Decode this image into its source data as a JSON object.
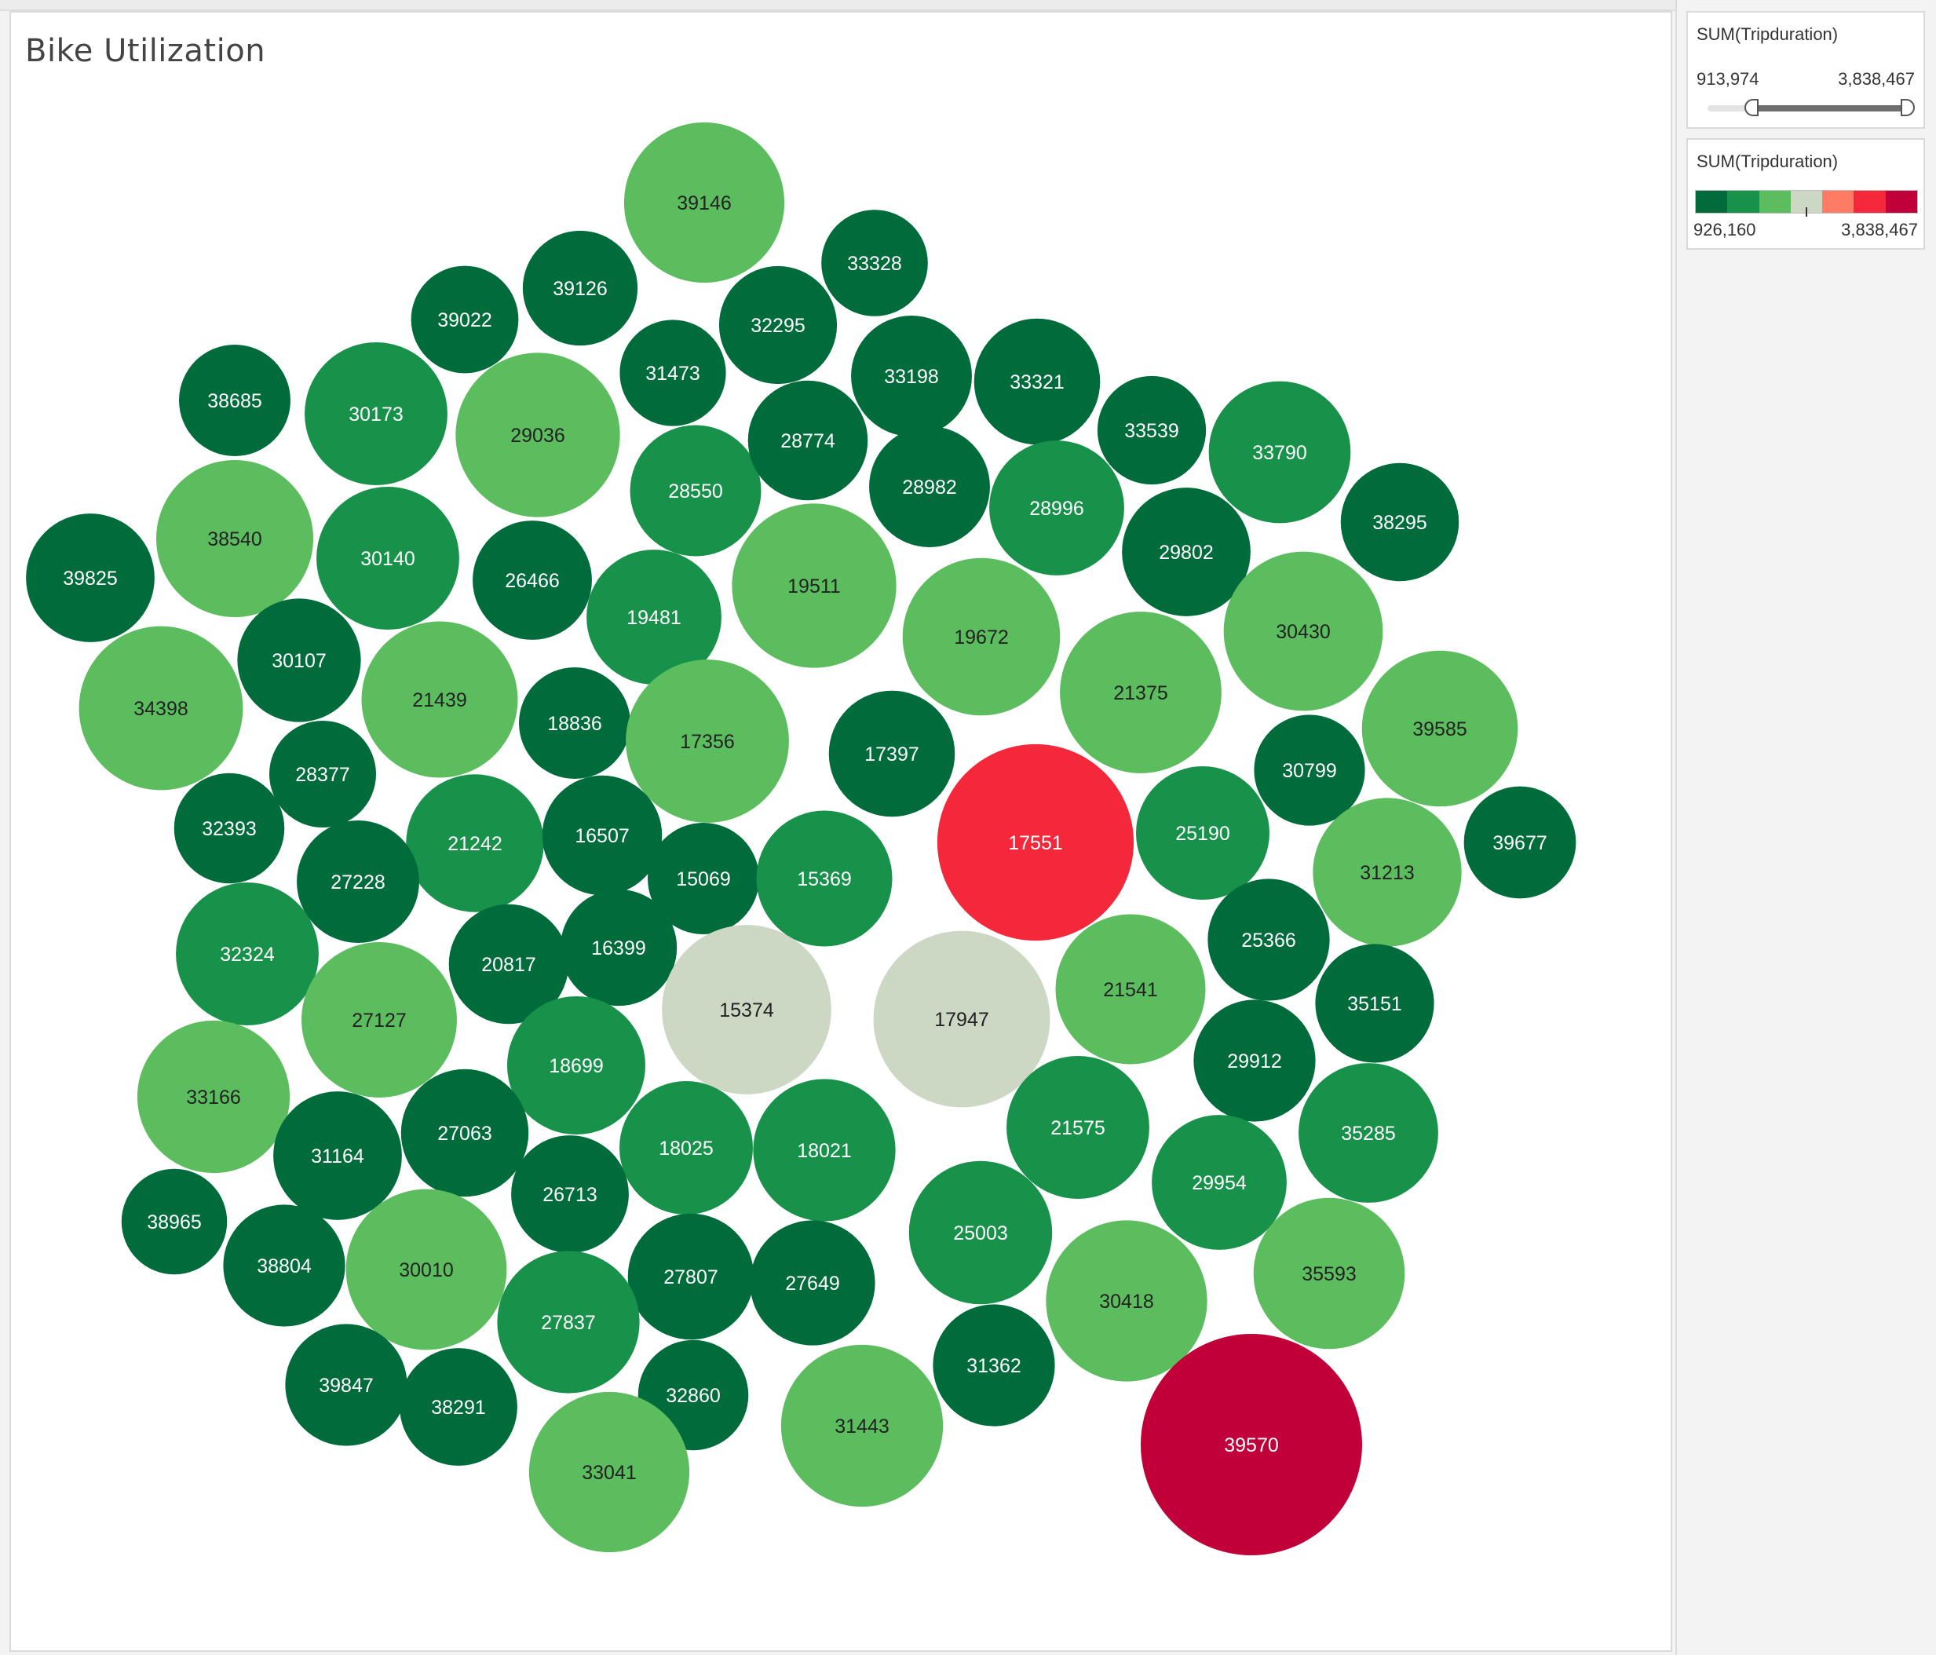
{
  "chart_data": {
    "type": "bubble",
    "title": "Bike Utilization",
    "measure": "SUM(Tripduration)",
    "label_field": "Bikeid",
    "size_range": {
      "min": 913974,
      "max": 3838467
    },
    "color_range": {
      "min": 926160,
      "max": 3838467
    },
    "palette": [
      "#006b3b",
      "#18924a",
      "#5cbd5e",
      "#ccd8c4",
      "#ff7b63",
      "#f4283a",
      "#c1003a"
    ],
    "bubbles": [
      {
        "id": "39146",
        "value": 2050000
      },
      {
        "id": "33328",
        "value": 935000
      },
      {
        "id": "39022",
        "value": 950000
      },
      {
        "id": "39126",
        "value": 1080000
      },
      {
        "id": "32295",
        "value": 1135000
      },
      {
        "id": "38685",
        "value": 1020000
      },
      {
        "id": "30173",
        "value": 1640000
      },
      {
        "id": "29036",
        "value": 2150000
      },
      {
        "id": "31473",
        "value": 930000
      },
      {
        "id": "33198",
        "value": 1190000
      },
      {
        "id": "33321",
        "value": 1290000
      },
      {
        "id": "33539",
        "value": 970000
      },
      {
        "id": "33790",
        "value": 1620000
      },
      {
        "id": "28550",
        "value": 1390000
      },
      {
        "id": "28774",
        "value": 1170000
      },
      {
        "id": "28982",
        "value": 1190000
      },
      {
        "id": "28996",
        "value": 1470000
      },
      {
        "id": "38540",
        "value": 1970000
      },
      {
        "id": "30140",
        "value": 1640000
      },
      {
        "id": "26466",
        "value": 1160000
      },
      {
        "id": "19481",
        "value": 1470000
      },
      {
        "id": "19511",
        "value": 2150000
      },
      {
        "id": "29802",
        "value": 1340000
      },
      {
        "id": "38295",
        "value": 1140000
      },
      {
        "id": "39825",
        "value": 1340000
      },
      {
        "id": "19672",
        "value": 1980000
      },
      {
        "id": "30430",
        "value": 2020000
      },
      {
        "id": "30107",
        "value": 1240000
      },
      {
        "id": "21439",
        "value": 1950000
      },
      {
        "id": "34398",
        "value": 2140000
      },
      {
        "id": "18836",
        "value": 1020000
      },
      {
        "id": "17356",
        "value": 2120000
      },
      {
        "id": "21375",
        "value": 2080000
      },
      {
        "id": "39585",
        "value": 1940000
      },
      {
        "id": "17397",
        "value": 1290000
      },
      {
        "id": "30799",
        "value": 1010000
      },
      {
        "id": "28377",
        "value": 940000
      },
      {
        "id": "17551",
        "value": 3040000
      },
      {
        "id": "32393",
        "value": 1000000
      },
      {
        "id": "21242",
        "value": 1530000
      },
      {
        "id": "16507",
        "value": 1170000
      },
      {
        "id": "15069",
        "value": 1020000
      },
      {
        "id": "15369",
        "value": 1490000
      },
      {
        "id": "25190",
        "value": 1440000
      },
      {
        "id": "31213",
        "value": 1770000
      },
      {
        "id": "39677",
        "value": 1030000
      },
      {
        "id": "27228",
        "value": 1220000
      },
      {
        "id": "25366",
        "value": 1210000
      },
      {
        "id": "32324",
        "value": 1640000
      },
      {
        "id": "20817",
        "value": 1170000
      },
      {
        "id": "16399",
        "value": 1110000
      },
      {
        "id": "15374",
        "value": 2280000
      },
      {
        "id": "17947",
        "value": 2470000
      },
      {
        "id": "21541",
        "value": 1800000
      },
      {
        "id": "35151",
        "value": 1150000
      },
      {
        "id": "27127",
        "value": 1930000
      },
      {
        "id": "29912",
        "value": 1210000
      },
      {
        "id": "33166",
        "value": 1860000
      },
      {
        "id": "18699",
        "value": 1540000
      },
      {
        "id": "21575",
        "value": 1640000
      },
      {
        "id": "35285",
        "value": 1570000
      },
      {
        "id": "27063",
        "value": 1320000
      },
      {
        "id": "31164",
        "value": 1340000
      },
      {
        "id": "18025",
        "value": 1440000
      },
      {
        "id": "18021",
        "value": 1630000
      },
      {
        "id": "29954",
        "value": 1470000
      },
      {
        "id": "26713",
        "value": 1130000
      },
      {
        "id": "38965",
        "value": 920000
      },
      {
        "id": "25003",
        "value": 1650000
      },
      {
        "id": "38804",
        "value": 1210000
      },
      {
        "id": "30010",
        "value": 2060000
      },
      {
        "id": "27807",
        "value": 1290000
      },
      {
        "id": "27649",
        "value": 1270000
      },
      {
        "id": "35593",
        "value": 1830000
      },
      {
        "id": "30418",
        "value": 2070000
      },
      {
        "id": "27837",
        "value": 1630000
      },
      {
        "id": "39847",
        "value": 1210000
      },
      {
        "id": "38291",
        "value": 1130000
      },
      {
        "id": "32860",
        "value": 1000000
      },
      {
        "id": "31362",
        "value": 1210000
      },
      {
        "id": "31443",
        "value": 2090000
      },
      {
        "id": "33041",
        "value": 2050000
      },
      {
        "id": "39570",
        "value": 3838467
      }
    ]
  },
  "legends": {
    "size": {
      "title": "SUM(Tripduration)",
      "min_label": "913,974",
      "max_label": "3,838,467"
    },
    "color": {
      "title": "SUM(Tripduration)",
      "min_label": "926,160",
      "max_label": "3,838,467"
    }
  }
}
